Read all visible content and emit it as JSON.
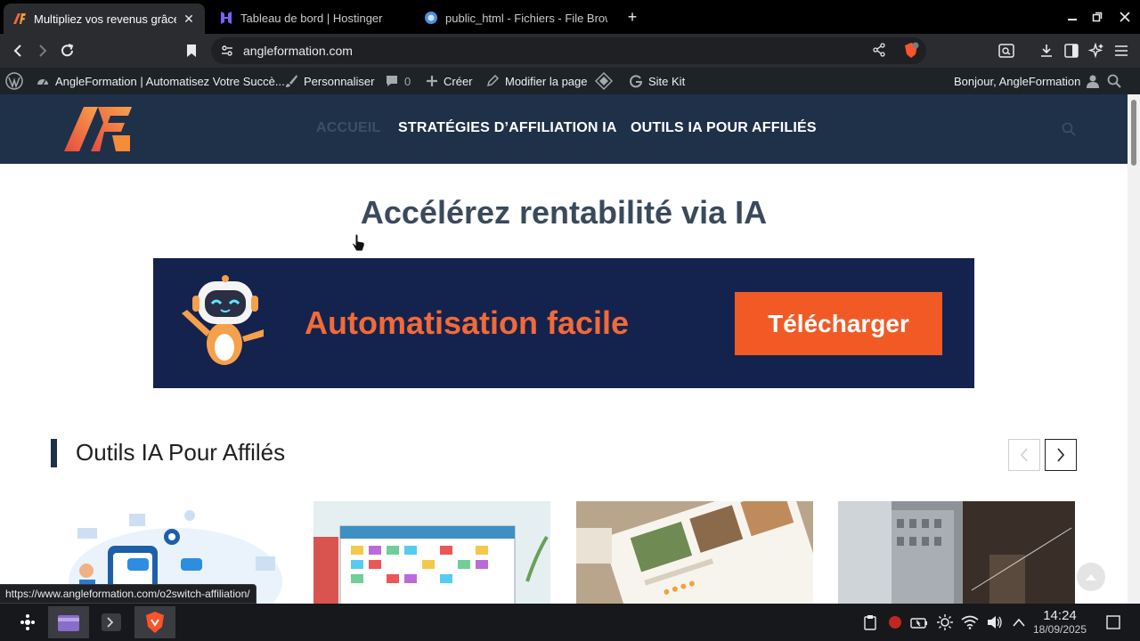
{
  "browser": {
    "tabs": [
      {
        "title": "Multipliez vos revenus grâce",
        "active": true
      },
      {
        "title": "Tableau de bord | Hostinger",
        "active": false
      },
      {
        "title": "public_html - Fichiers - File Brow",
        "active": false
      }
    ],
    "new_tab": "+",
    "url": "angleformation.com",
    "shield_badge": "0",
    "status_url": "https://www.angleformation.com/o2switch-affiliation/"
  },
  "adminbar": {
    "site_name": "AngleFormation | Automatisez Votre Succè...",
    "customize": "Personnaliser",
    "comments_count": "0",
    "create": "Créer",
    "edit_page": "Modifier la page",
    "site_kit": "Site Kit",
    "greeting": "Bonjour, AngleFormation"
  },
  "site": {
    "nav": [
      "ACCUEIL",
      "STRATÉGIES D’AFFILIATION IA",
      "OUTILS IA POUR AFFILIÉS"
    ],
    "hero_title": "Accélérez rentabilité via IA",
    "banner": {
      "text": "Automatisation facile",
      "button": "Télécharger"
    },
    "section_title": "Outils IA Pour Affilés"
  },
  "taskbar": {
    "time": "14:24",
    "date": "18/09/2025"
  },
  "colors": {
    "header_bg": "#1f3049",
    "banner_bg": "#14234d",
    "accent_orange": "#f15a24",
    "adminbar_bg": "#1d2327"
  }
}
